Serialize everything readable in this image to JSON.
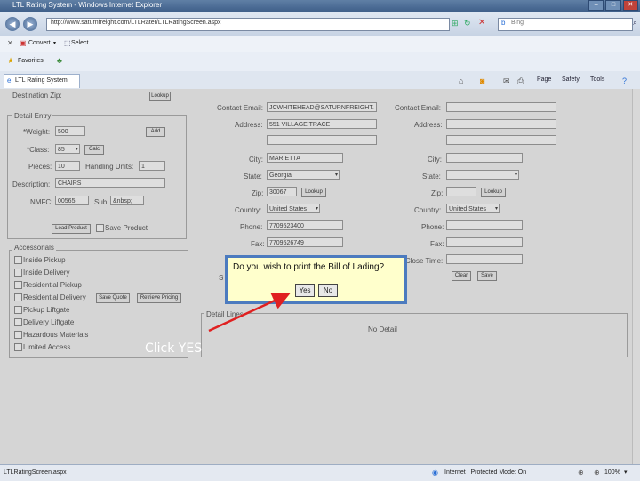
{
  "window": {
    "title": "LTL Rating System - Windows Internet Explorer"
  },
  "address_bar": {
    "url": "http://www.saturnfreight.com/LTLRater/LTLRatingScreen.aspx",
    "search_placeholder": "Bing"
  },
  "menubar": {
    "convert": "Convert",
    "select": "Select"
  },
  "favbar": {
    "favorites": "Favorites"
  },
  "tab": {
    "label": "LTL Rating System"
  },
  "command_bar": {
    "page": "Page",
    "safety": "Safety",
    "tools": "Tools"
  },
  "form": {
    "destination_zip_label": "Destination Zip:",
    "lookup": "Lookup",
    "detail_entry": "Detail Entry",
    "weight_label": "*Weight:",
    "weight_value": "500",
    "add_button": "Add",
    "class_label": "*Class:",
    "class_value": "85",
    "calc_button": "Calc",
    "pieces_label": "Pieces:",
    "pieces_value": "10",
    "handling_units_label": "Handling Units:",
    "handling_units_value": "1",
    "description_label": "Description:",
    "description_value": "CHAIRS",
    "nmfc_label": "NMFC:",
    "nmfc_value": "00565",
    "sub_label": "Sub:",
    "sub_value": "&nbsp;",
    "load_product": "Load Product",
    "save_product": "Save Product",
    "accessorials_title": "Accessorials",
    "accessorials": [
      "Inside Pickup",
      "Inside Delivery",
      "Residential Pickup",
      "Residential Delivery",
      "Pickup Liftgate",
      "Delivery Liftgate",
      "Hazardous Materials",
      "Limited Access"
    ],
    "save_quote": "Save Quote",
    "retrieve_pricing": "Retrieve Pricing",
    "contact_email_label": "Contact Email:",
    "contact_email_value": "JCWHITEHEAD@SATURNFREIGHT.",
    "address_label": "Address:",
    "address_value": "551 VILLAGE TRACE",
    "city_label": "City:",
    "city_value": "MARIETTA",
    "state_label": "State:",
    "state_value": "Georgia",
    "zip_label": "Zip:",
    "zip_value": "30067",
    "country_label": "Country:",
    "country_value": "United States",
    "phone_label": "Phone:",
    "phone_value": "7709523400",
    "fax_label": "Fax:",
    "fax_value": "7709526749",
    "close_time_label": "Close Time:",
    "clear": "Clear",
    "save": "Save",
    "detail_lines_label": "Detail Lines",
    "no_detail": "No Detail",
    "s_label": "S"
  },
  "dialog": {
    "message": "Do you wish to print the Bill of Lading?",
    "yes": "Yes",
    "no": "No"
  },
  "annotation": {
    "text": "Click YES",
    "arrow_color": "#e02020"
  },
  "status_bar": {
    "page": "LTLRatingScreen.aspx",
    "zone": "Internet | Protected Mode: On",
    "zoom": "100%"
  }
}
